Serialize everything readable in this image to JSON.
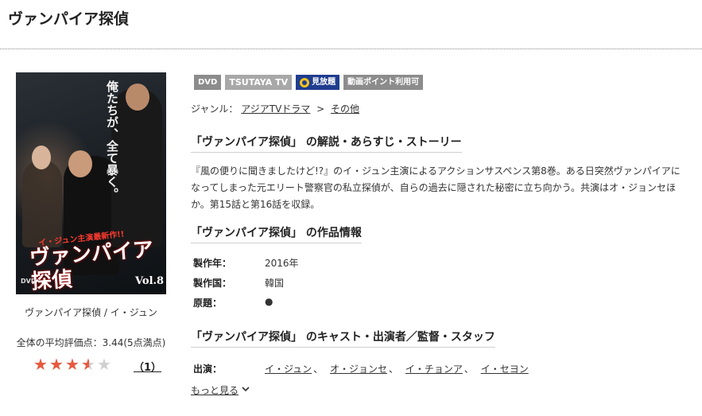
{
  "page": {
    "title": "ヴァンパイア探偵"
  },
  "jacket": {
    "vertical_text": "俺たちが、全て暴く。",
    "tagline": "イ・ジュン主演最新作!!",
    "logo": "ヴァンパイア探偵",
    "vol": "Vol.8",
    "format": "DVD",
    "caption": "ヴァンパイア探偵 / イ・ジュン"
  },
  "rating": {
    "text": "全体の平均評価点：3.44(5点満点)",
    "score": 3.44,
    "max": 5,
    "review_count": "（1）",
    "colors": {
      "filled": "#e8593f",
      "empty": "#cfcfcf"
    }
  },
  "badges": [
    "DVD",
    "TSUTAYA TV",
    "見放題",
    "動画ポイント利用可"
  ],
  "genre": {
    "label": "ジャンル：",
    "path": [
      "アジアTVドラマ",
      "その他"
    ],
    "separator": ">"
  },
  "sections": {
    "synopsis_heading": "「ヴァンパイア探偵」 の解説・あらすじ・ストーリー",
    "synopsis": "『風の便りに聞きましたけど!?』のイ・ジュン主演によるアクションサスペンス第8巻。ある日突然ヴァンパイアになってしまった元エリート警察官の私立探偵が、自らの過去に隠された秘密に立ち向かう。共演はオ・ジョンセほか。第15話と第16話を収録。",
    "info_heading": "「ヴァンパイア探偵」 の作品情報",
    "cast_heading": "「ヴァンパイア探偵」 のキャスト・出演者／監督・スタッフ"
  },
  "info": [
    {
      "label": "製作年：",
      "value": "2016年"
    },
    {
      "label": "製作国：",
      "value": "韓国"
    },
    {
      "label": "原題：",
      "value": "●"
    }
  ],
  "cast": {
    "label": "出演：",
    "names": [
      "イ・ジュン",
      "オ・ジョンセ",
      "イ・チョンア",
      "イ・セヨン"
    ],
    "separator": "、",
    "more": "もっと見る"
  },
  "colors": {
    "mihodai_badge": "#1f3d8f",
    "badge_gray": "#8c8c8c"
  }
}
